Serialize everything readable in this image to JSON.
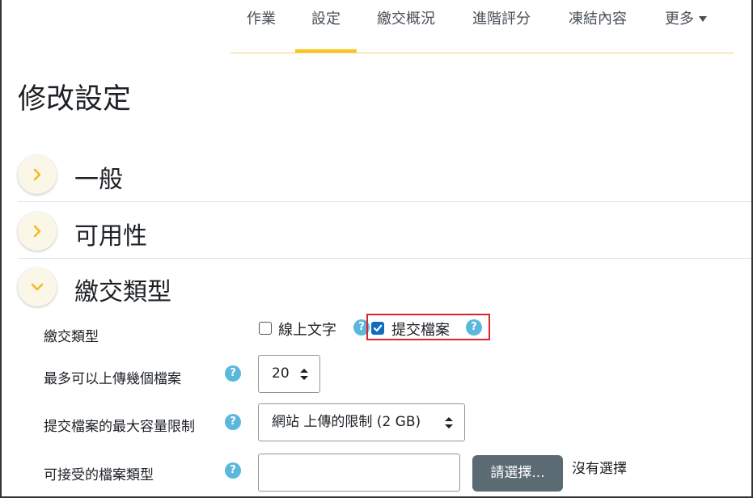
{
  "nav": {
    "tabs": [
      {
        "label": "作業"
      },
      {
        "label": "設定"
      },
      {
        "label": "繳交概況"
      },
      {
        "label": "進階評分"
      },
      {
        "label": "凍結內容"
      },
      {
        "label": "更多"
      }
    ],
    "active_tab": "設定"
  },
  "page_title": "修改設定",
  "sections": [
    {
      "label": "一般",
      "expanded": false
    },
    {
      "label": "可用性",
      "expanded": false
    },
    {
      "label": "繳交類型",
      "expanded": true
    }
  ],
  "form": {
    "submission_types": {
      "label": "繳交類型",
      "options": [
        {
          "label": "線上文字",
          "checked": false
        },
        {
          "label": "提交檔案",
          "checked": true
        }
      ]
    },
    "max_files": {
      "label": "最多可以上傳幾個檔案",
      "value": "20"
    },
    "max_size": {
      "label": "提交檔案的最大容量限制",
      "value": "網站 上傳的限制 (2 GB)"
    },
    "accepted_types": {
      "label": "可接受的檔案類型",
      "button_label": "請選擇...",
      "status": "沒有選擇",
      "value": ""
    }
  },
  "help_glyph": "?",
  "colors": {
    "accent": "#f8c51c",
    "help": "#5bb8dc",
    "checkbox": "#0f6cbf",
    "highlight": "#d9262c",
    "button": "#5a6b73"
  }
}
